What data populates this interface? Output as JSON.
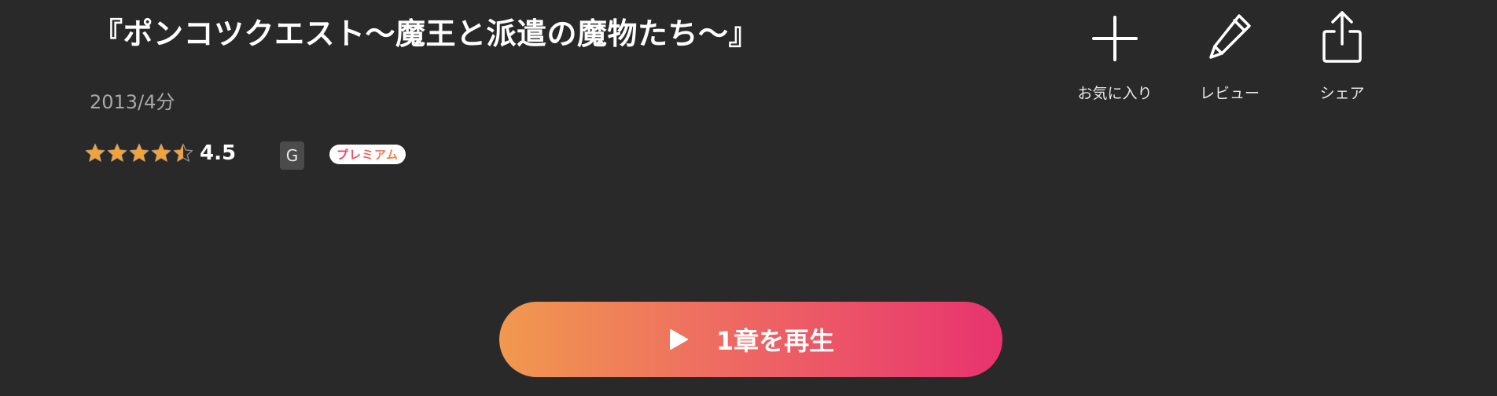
{
  "work": {
    "title": "『ポンコツクエスト〜魔王と派遣の魔物たち〜』",
    "meta": "2013/4分",
    "rating_value": "4.5",
    "rating_score": 4.5,
    "rating_max": 5,
    "age_rating": "G",
    "premium_label": "プレミアム"
  },
  "actions": {
    "favorite_label": "お気に入り",
    "review_label": "レビュー",
    "share_label": "シェア"
  },
  "play": {
    "label": "1章を再生"
  },
  "colors": {
    "background": "#292929",
    "star_fill": "#f3a23b",
    "play_gradient_start": "#f0994e",
    "play_gradient_end": "#e8336f"
  }
}
